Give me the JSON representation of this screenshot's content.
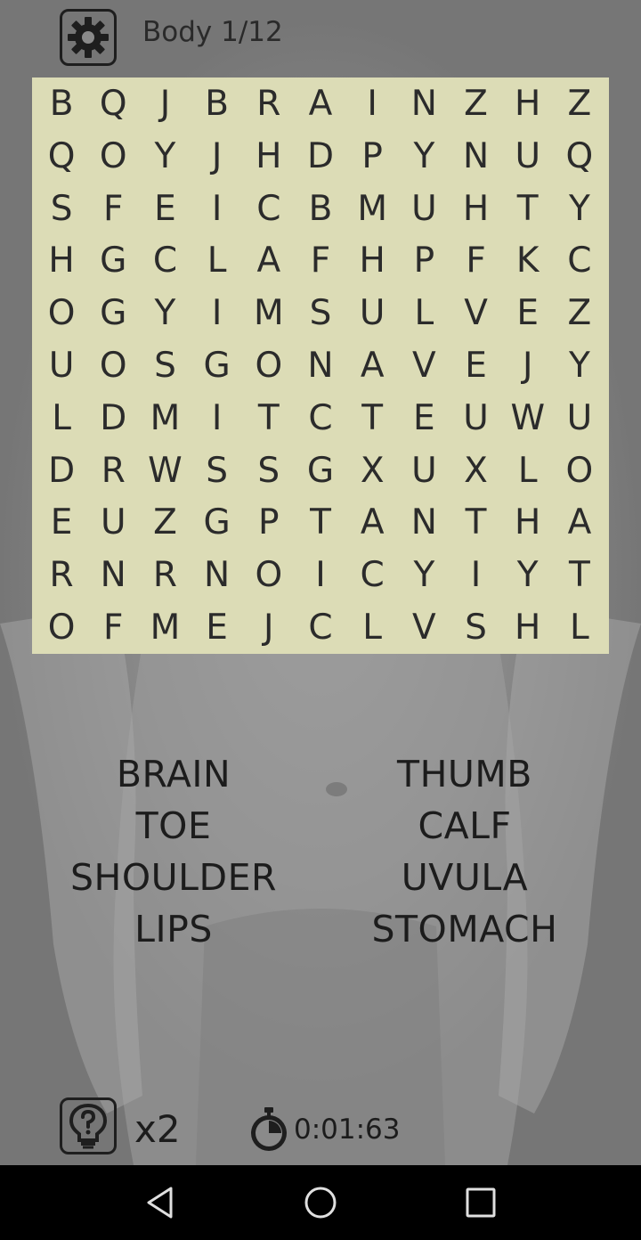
{
  "header": {
    "title": "Body 1/12",
    "settings_icon": "gear-icon"
  },
  "grid": [
    [
      "B",
      "Q",
      "J",
      "B",
      "R",
      "A",
      "I",
      "N",
      "Z",
      "H",
      "Z"
    ],
    [
      "Q",
      "O",
      "Y",
      "J",
      "H",
      "D",
      "P",
      "Y",
      "N",
      "U",
      "Q"
    ],
    [
      "S",
      "F",
      "E",
      "I",
      "C",
      "B",
      "M",
      "U",
      "H",
      "T",
      "Y"
    ],
    [
      "H",
      "G",
      "C",
      "L",
      "A",
      "F",
      "H",
      "P",
      "F",
      "K",
      "C"
    ],
    [
      "O",
      "G",
      "Y",
      "I",
      "M",
      "S",
      "U",
      "L",
      "V",
      "E",
      "Z"
    ],
    [
      "U",
      "O",
      "S",
      "G",
      "O",
      "N",
      "A",
      "V",
      "E",
      "J",
      "Y"
    ],
    [
      "L",
      "D",
      "M",
      "I",
      "T",
      "C",
      "T",
      "E",
      "U",
      "W",
      "U"
    ],
    [
      "D",
      "R",
      "W",
      "S",
      "S",
      "G",
      "X",
      "U",
      "X",
      "L",
      "O"
    ],
    [
      "E",
      "U",
      "Z",
      "G",
      "P",
      "T",
      "A",
      "N",
      "T",
      "H",
      "A"
    ],
    [
      "R",
      "N",
      "R",
      "N",
      "O",
      "I",
      "C",
      "Y",
      "I",
      "Y",
      "T"
    ],
    [
      "O",
      "F",
      "M",
      "E",
      "J",
      "C",
      "L",
      "V",
      "S",
      "H",
      "L"
    ]
  ],
  "words": [
    "BRAIN",
    "THUMB",
    "TOE",
    "CALF",
    "SHOULDER",
    "UVULA",
    "LIPS",
    "STOMACH"
  ],
  "footer": {
    "hint_icon": "lightbulb-question-icon",
    "hint_count": "x2",
    "timer_icon": "stopwatch-icon",
    "timer": "0:01:63"
  },
  "navbar": {
    "back_icon": "back-triangle-icon",
    "home_icon": "home-circle-icon",
    "recents_icon": "recents-square-icon"
  },
  "colors": {
    "grid_background": "#dcdcb6",
    "text": "#2b2b2b",
    "background": "#8a8a8a",
    "navbar": "#000000"
  }
}
